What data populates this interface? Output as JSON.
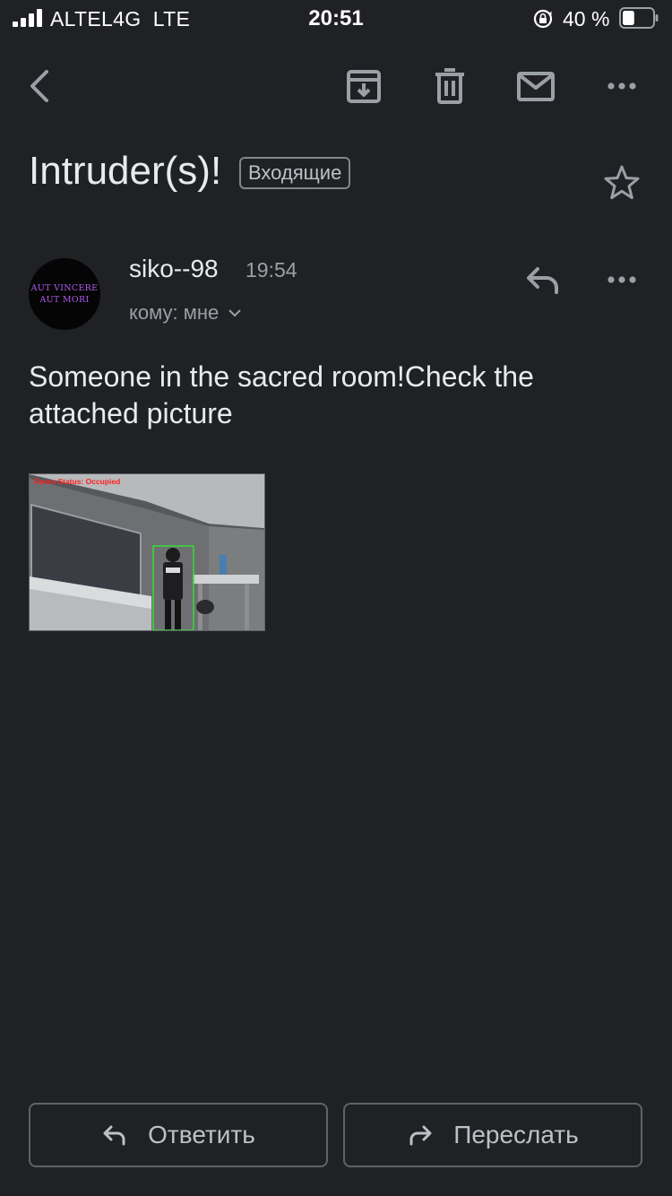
{
  "status_bar": {
    "carrier": "ALTEL4G  LTE",
    "time": "20:51",
    "battery_percent": "40 %",
    "battery_level": 0.4
  },
  "toolbar": {
    "back_icon": "chevron-left-icon",
    "archive_icon": "archive-icon",
    "delete_icon": "trash-icon",
    "mark_unread_icon": "mail-icon",
    "more_icon": "more-horizontal-icon"
  },
  "message": {
    "subject": "Intruder(s)!",
    "label": "Входящие",
    "sender_name": "siko--98",
    "time": "19:54",
    "recipient": "кому: мне",
    "avatar_text": [
      "AUT VINCERE",
      "AUT MORI"
    ],
    "body": "Someone in the sacred room!Check the attached picture",
    "attachment_caption": "Room Status: Occupied"
  },
  "actions": {
    "reply_label": "Ответить",
    "forward_label": "Переслать"
  },
  "colors": {
    "background": "#202124",
    "text_primary": "#e8eaed",
    "text_secondary": "#9aa0a6",
    "icon": "#9aa0a6",
    "border": "#5f6368",
    "detection_box": "#39d63b",
    "caption_red": "#ff1f1f",
    "avatar_text": "#b05bf0"
  }
}
